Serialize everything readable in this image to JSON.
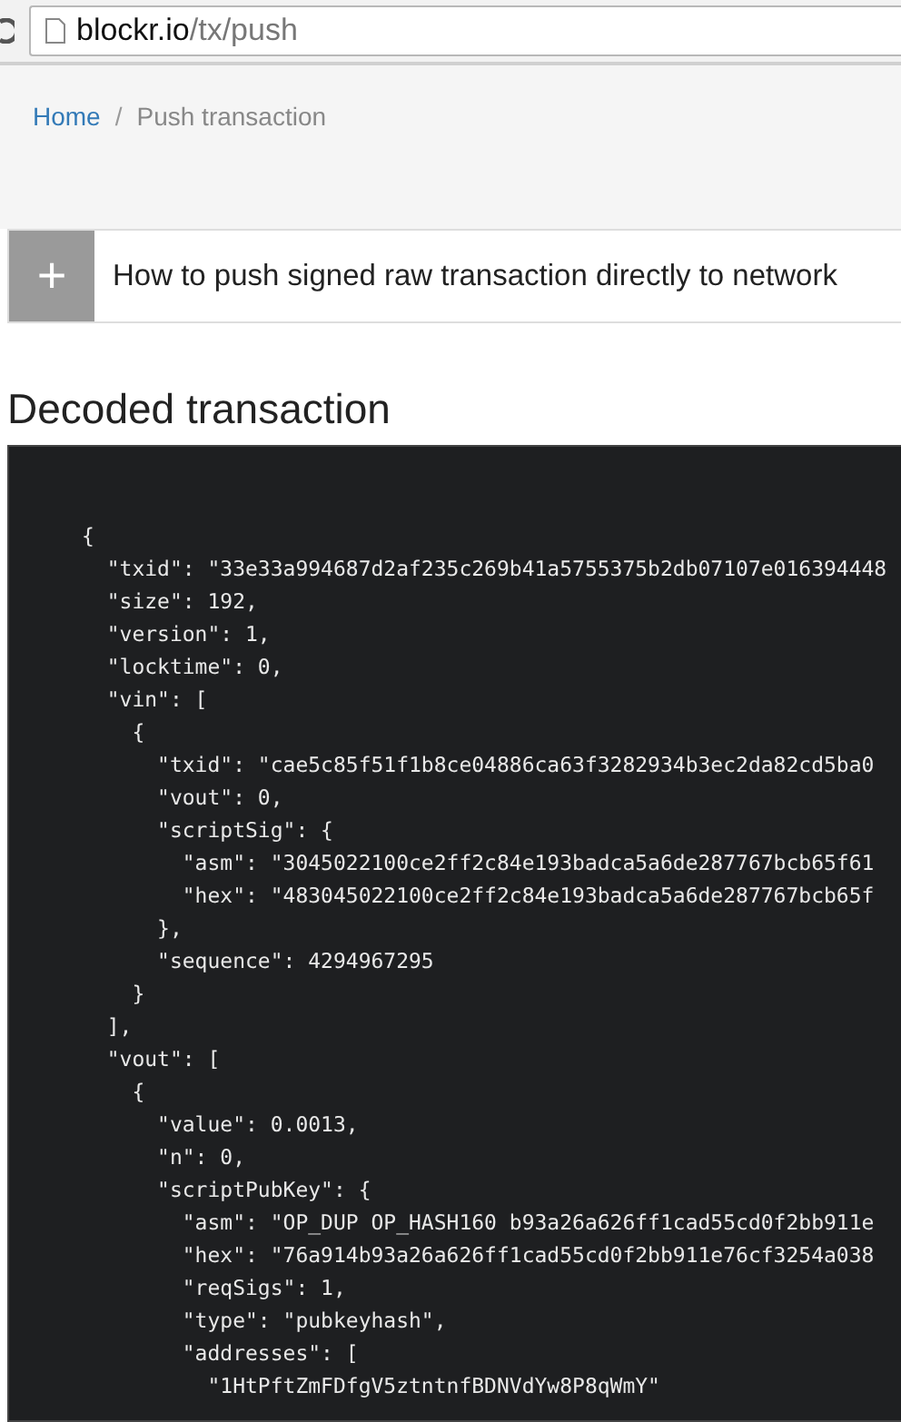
{
  "browser": {
    "url_host": "blockr.io",
    "url_path": "/tx/push"
  },
  "breadcrumb_separator": "/",
  "breadcrumb": [
    {
      "label": "Home",
      "kind": "link"
    },
    {
      "label": "Push transaction",
      "kind": "current"
    }
  ],
  "accordion": {
    "icon_label": "+",
    "title": "How to push signed raw transaction directly to network",
    "expanded": false
  },
  "heading": "Decoded transaction",
  "code_lines": [
    "{",
    "  \"txid\": \"33e33a994687d2af235c269b41a5755375b2db07107e016394448",
    "  \"size\": 192,",
    "  \"version\": 1,",
    "  \"locktime\": 0,",
    "  \"vin\": [",
    "    {",
    "      \"txid\": \"cae5c85f51f1b8ce04886ca63f3282934b3ec2da82cd5ba0",
    "      \"vout\": 0,",
    "      \"scriptSig\": {",
    "        \"asm\": \"3045022100ce2ff2c84e193badca5a6de287767bcb65f61",
    "        \"hex\": \"483045022100ce2ff2c84e193badca5a6de287767bcb65f",
    "      },",
    "      \"sequence\": 4294967295",
    "    }",
    "  ],",
    "  \"vout\": [",
    "    {",
    "      \"value\": 0.0013,",
    "      \"n\": 0,",
    "      \"scriptPubKey\": {",
    "        \"asm\": \"OP_DUP OP_HASH160 b93a26a626ff1cad55cd0f2bb911e",
    "        \"hex\": \"76a914b93a26a626ff1cad55cd0f2bb911e76cf3254a038",
    "        \"reqSigs\": 1,",
    "        \"type\": \"pubkeyhash\",",
    "        \"addresses\": [",
    "          \"1HtPftZmFDfgV5ztntnfBDNVdYw8P8qWmY\""
  ]
}
